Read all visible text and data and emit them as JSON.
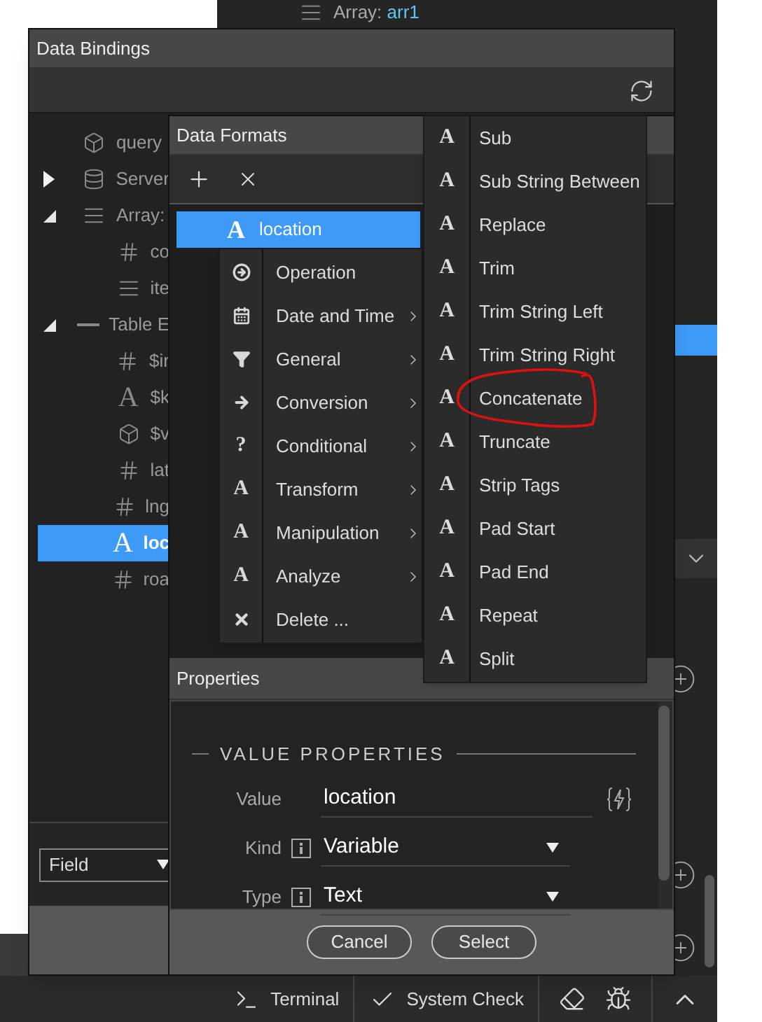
{
  "background_panel": {
    "array_label": "Array:",
    "array_name": "arr1"
  },
  "data_bindings": {
    "title": "Data Bindings",
    "tree": [
      {
        "kind": "object",
        "label": "query",
        "selected": false
      },
      {
        "kind": "database",
        "label": "Server",
        "expanded": false,
        "selected": false
      },
      {
        "kind": "array",
        "label": "Array:",
        "expanded": true,
        "selected": false,
        "children": [
          {
            "kind": "number",
            "label": "co",
            "selected": false
          },
          {
            "kind": "array",
            "label": "ite",
            "selected": false
          }
        ]
      },
      {
        "kind": "table",
        "label": "Table E",
        "expanded": true,
        "selected": false,
        "children": [
          {
            "kind": "number",
            "label": "$ir",
            "selected": false
          },
          {
            "kind": "text",
            "glyph": "A",
            "label": "$k",
            "selected": false
          },
          {
            "kind": "object",
            "label": "$v",
            "selected": false
          },
          {
            "kind": "number",
            "label": "lat",
            "selected": false
          },
          {
            "kind": "number",
            "label": "lng",
            "selected": false
          },
          {
            "kind": "text",
            "glyph": "A",
            "label": "loc",
            "selected": true
          },
          {
            "kind": "number",
            "label": "roa",
            "selected": false
          }
        ]
      }
    ],
    "field_select": {
      "value": "Field"
    }
  },
  "data_formats": {
    "title": "Data Formats",
    "items": [
      {
        "glyph": "A",
        "label": "location",
        "selected": true
      }
    ],
    "context_menu": [
      {
        "kind": "operation",
        "label": "Operation",
        "submenu": false
      },
      {
        "kind": "calendar",
        "label": "Date and Time",
        "submenu": true
      },
      {
        "kind": "filter",
        "label": "General",
        "submenu": true
      },
      {
        "kind": "convert",
        "label": "Conversion",
        "submenu": true
      },
      {
        "kind": "glyph",
        "glyph": "?",
        "label": "Conditional",
        "submenu": true
      },
      {
        "kind": "glyph",
        "glyph": "A",
        "label": "Transform",
        "submenu": true
      },
      {
        "kind": "glyph",
        "glyph": "A",
        "label": "Manipulation",
        "submenu": true
      },
      {
        "kind": "glyph",
        "glyph": "A",
        "label": "Analyze",
        "submenu": true
      },
      {
        "kind": "delete",
        "label": "Delete ...",
        "submenu": false
      }
    ],
    "submenu": [
      {
        "glyph": "A",
        "label": "Sub"
      },
      {
        "glyph": "A",
        "label": "Sub String Between"
      },
      {
        "glyph": "A",
        "label": "Replace"
      },
      {
        "glyph": "A",
        "label": "Trim"
      },
      {
        "glyph": "A",
        "label": "Trim String Left"
      },
      {
        "glyph": "A",
        "label": "Trim String Right"
      },
      {
        "glyph": "A",
        "label": "Concatenate",
        "circled": true
      },
      {
        "glyph": "A",
        "label": "Truncate"
      },
      {
        "glyph": "A",
        "label": "Strip Tags"
      },
      {
        "glyph": "A",
        "label": "Pad Start"
      },
      {
        "glyph": "A",
        "label": "Pad End"
      },
      {
        "glyph": "A",
        "label": "Repeat"
      },
      {
        "glyph": "A",
        "label": "Split"
      }
    ]
  },
  "properties": {
    "title": "Properties",
    "section": "VALUE PROPERTIES",
    "fields": [
      {
        "kind": "text",
        "label": "Value",
        "value": "location"
      },
      {
        "kind": "select",
        "label": "Kind",
        "value": "Variable"
      },
      {
        "kind": "select",
        "label": "Type",
        "value": "Text"
      }
    ]
  },
  "buttons": [
    "Cancel",
    "Select"
  ],
  "status_bar": {
    "items": [
      {
        "kind": "terminal",
        "label": "Terminal"
      },
      {
        "kind": "check",
        "label": "System Check"
      }
    ]
  }
}
